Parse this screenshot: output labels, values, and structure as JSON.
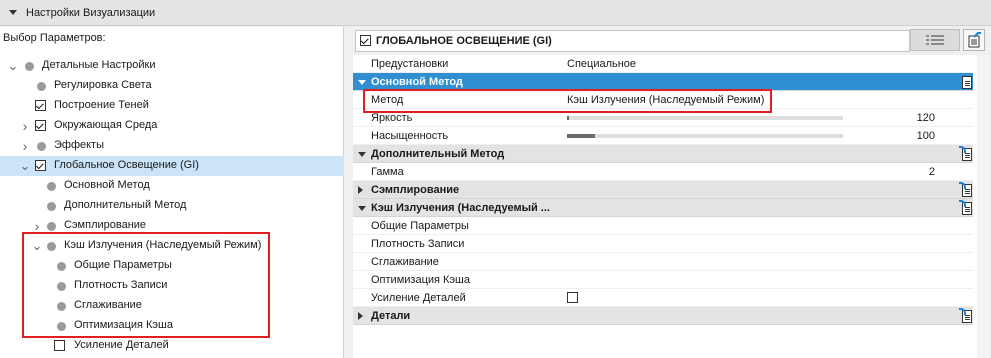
{
  "header": {
    "title": "Настройки Визуализации"
  },
  "left_panel": {
    "section_label": "Выбор Параметров:",
    "tree": [
      {
        "label": "Детальные Настройки",
        "expand": "down",
        "marker": "dot"
      },
      {
        "label": "Регулировка Света",
        "marker": "dot"
      },
      {
        "label": "Построение Теней",
        "marker": "checkbox",
        "checked": true
      },
      {
        "label": "Окружающая Среда",
        "expand": "right",
        "marker": "checkbox",
        "checked": true
      },
      {
        "label": "Эффекты",
        "expand": "right",
        "marker": "dot"
      },
      {
        "label": "Глобальное Освещение (GI)",
        "expand": "down",
        "marker": "checkbox",
        "checked": true,
        "selected": true
      },
      {
        "label": "Основной Метод",
        "marker": "dot"
      },
      {
        "label": "Дополнительный Метод",
        "marker": "dot"
      },
      {
        "label": "Сэмплирование",
        "expand": "right",
        "marker": "dot"
      },
      {
        "label": "Кэш Излучения (Наследуемый Режим)",
        "expand": "down",
        "marker": "dot"
      },
      {
        "label": "Общие Параметры",
        "marker": "dot"
      },
      {
        "label": "Плотность Записи",
        "marker": "dot"
      },
      {
        "label": "Сглаживание",
        "marker": "dot"
      },
      {
        "label": "Оптимизация Кэша",
        "marker": "dot"
      },
      {
        "label": "Усиление Деталей",
        "marker": "checkbox",
        "checked": false
      }
    ]
  },
  "right_panel": {
    "title": "ГЛОБАЛЬНОЕ ОСВЕЩЕНИЕ (GI)",
    "title_checked": true,
    "rows": [
      {
        "type": "item",
        "key": "Предустановки",
        "value": "Специальное"
      },
      {
        "type": "group",
        "key": "Основной Метод",
        "expanded": true,
        "active": true
      },
      {
        "type": "item",
        "key": "Метод",
        "value": "Кэш Излучения (Наследуемый Режим)"
      },
      {
        "type": "slider",
        "key": "Яркость",
        "value": "120",
        "level": 0.005
      },
      {
        "type": "slider",
        "key": "Насыщенность",
        "value": "100",
        "level": 0.1
      },
      {
        "type": "group",
        "key": "Дополнительный Метод",
        "expanded": true
      },
      {
        "type": "item",
        "key": "Гамма",
        "number": "2"
      },
      {
        "type": "group",
        "key": "Сэмплирование",
        "expanded": false
      },
      {
        "type": "group",
        "key": "Кэш Излучения (Наследуемый ...",
        "expanded": true
      },
      {
        "type": "item",
        "key": "Общие Параметры"
      },
      {
        "type": "item",
        "key": "Плотность Записи"
      },
      {
        "type": "item",
        "key": "Сглаживание"
      },
      {
        "type": "item",
        "key": "Оптимизация Кэша"
      },
      {
        "type": "checkbox",
        "key": "Усиление Деталей",
        "checked": false
      },
      {
        "type": "group",
        "key": "Детали",
        "expanded": false
      }
    ]
  },
  "colors": {
    "accent": "#2f8fd0",
    "selection": "#cce4f7",
    "highlight_box": "#e02020"
  },
  "icons": {
    "list": "list-icon",
    "edit": "edit-page-icon",
    "group_side": "page-arrow-icon"
  }
}
